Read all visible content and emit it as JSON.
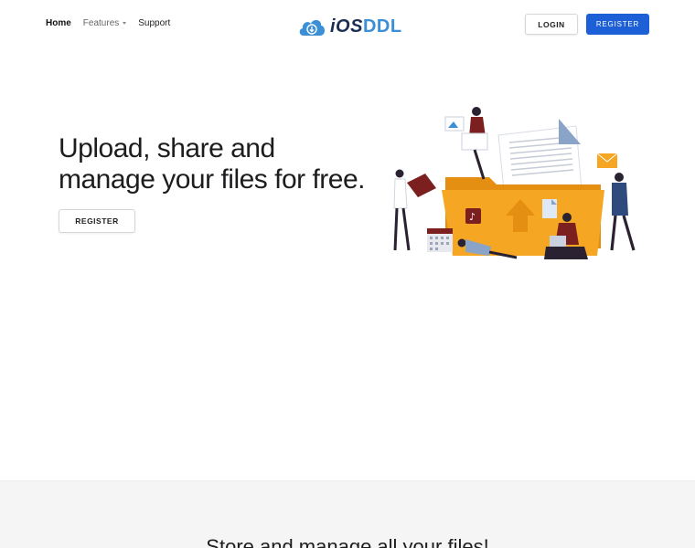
{
  "nav": {
    "items": [
      {
        "label": "Home"
      },
      {
        "label": "Features"
      },
      {
        "label": "Support"
      }
    ]
  },
  "logo": {
    "part1": "iOS",
    "part2": "DDL"
  },
  "header": {
    "login_label": "LOGIN",
    "register_label": "REGISTER"
  },
  "hero": {
    "title": "Upload, share and manage your files for free.",
    "register_label": "REGISTER"
  },
  "section2": {
    "title": "Store and manage all your files!"
  },
  "colors": {
    "primary_button": "#1c5fd6",
    "logo_dark": "#1c2f52",
    "logo_light": "#3a8fd6",
    "folder": "#f5a623",
    "section_bg": "#f5f5f6"
  }
}
